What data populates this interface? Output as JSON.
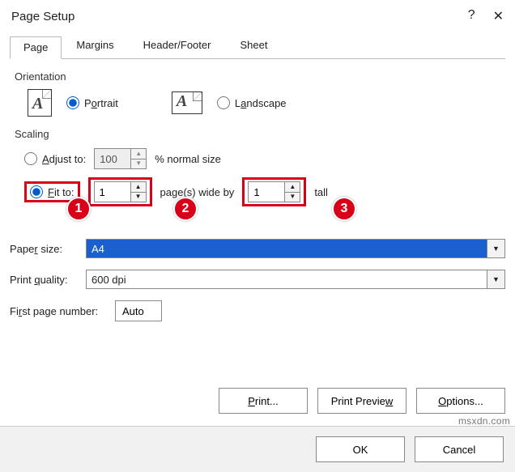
{
  "title": "Page Setup",
  "tabs": [
    "Page",
    "Margins",
    "Header/Footer",
    "Sheet"
  ],
  "orientation": {
    "group": "Orientation",
    "portrait": "Portrait",
    "landscape": "Landscape",
    "selected": "portrait"
  },
  "scaling": {
    "group": "Scaling",
    "adjust_label": "Adjust to:",
    "adjust_value": "100",
    "adjust_suffix": "% normal size",
    "fit_label": "Fit to:",
    "fit_wide": "1",
    "fit_mid": "page(s) wide by",
    "fit_tall_value": "1",
    "fit_tall": "tall",
    "selected": "fit"
  },
  "paper": {
    "label": "Paper size:",
    "raw": "Paper size:",
    "value": "A4"
  },
  "quality": {
    "label": "Print quality:",
    "value": "600 dpi"
  },
  "firstpage": {
    "label": "First page number:",
    "value": "Auto"
  },
  "buttons": {
    "print": "Print...",
    "preview": "Print Preview",
    "options": "Options...",
    "ok": "OK",
    "cancel": "Cancel"
  },
  "badges": {
    "b1": "1",
    "b2": "2",
    "b3": "3"
  },
  "watermark": "msxdn.com"
}
